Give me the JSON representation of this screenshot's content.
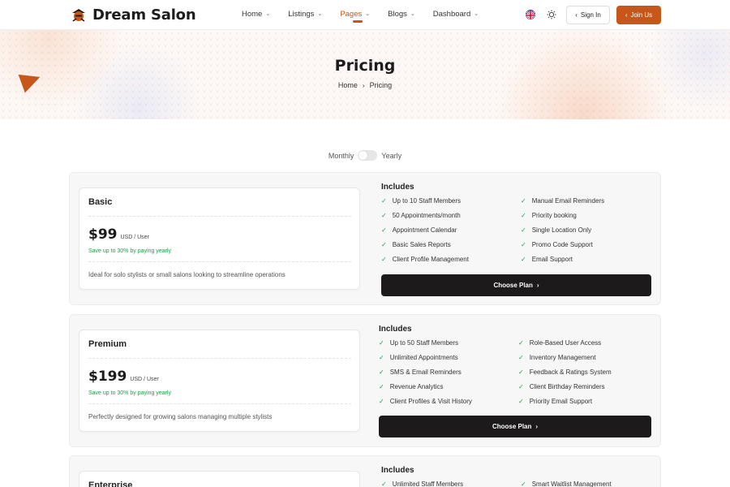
{
  "brand": {
    "name": "Dream Salon",
    "accent": "#c6561a",
    "dark": "#1c1a1a",
    "success": "#1f9d4a"
  },
  "nav": [
    {
      "label": "Home",
      "has_dropdown": true,
      "active": false
    },
    {
      "label": "Listings",
      "has_dropdown": true,
      "active": false
    },
    {
      "label": "Pages",
      "has_dropdown": true,
      "active": true
    },
    {
      "label": "Blogs",
      "has_dropdown": true,
      "active": false
    },
    {
      "label": "Dashboard",
      "has_dropdown": true,
      "active": false
    }
  ],
  "header": {
    "flag_icon": "uk-flag-icon",
    "theme_icon": "sun-icon",
    "signin_label": "Sign In",
    "join_label": "Join Us"
  },
  "hero": {
    "title": "Pricing",
    "breadcrumb": [
      "Home",
      "Pricing"
    ]
  },
  "billing_toggle": {
    "left_label": "Monthly",
    "right_label": "Yearly",
    "yearly_selected": false
  },
  "plans": [
    {
      "name": "Basic",
      "price": "$99",
      "unit": "USD / User",
      "save_text": "Save up to 30% by paying yearly",
      "description": "Ideal for solo stylists or small salons looking to streamline operations",
      "includes_label": "Includes",
      "features": [
        "Up to 10 Staff Members",
        "Manual Email Reminders",
        "50 Appointments/month",
        "Priority booking",
        "Appointment Calendar",
        "Single Location Only",
        "Basic Sales Reports",
        "Promo Code Support",
        "Client Profile Management",
        "Email Support"
      ],
      "cta": "Choose Plan"
    },
    {
      "name": "Premium",
      "price": "$199",
      "unit": "USD / User",
      "save_text": "Save up to 30% by paying yearly",
      "description": "Perfectly designed for growing salons managing multiple stylists",
      "includes_label": "Includes",
      "features": [
        "Up to 50 Staff Members",
        "Role-Based User Access",
        "Unlimited Appointments",
        "Inventory Management",
        "SMS & Email Reminders",
        "Feedback & Ratings System",
        "Revenue Analytics",
        "Client Birthday Reminders",
        "Client Profiles & Visit History",
        "Priority Email Support"
      ],
      "cta": "Choose Plan"
    },
    {
      "name": "Enterprise",
      "includes_label": "Includes",
      "features": [
        "Unlimited Staff Members",
        "Smart Waitlist Management"
      ]
    }
  ]
}
